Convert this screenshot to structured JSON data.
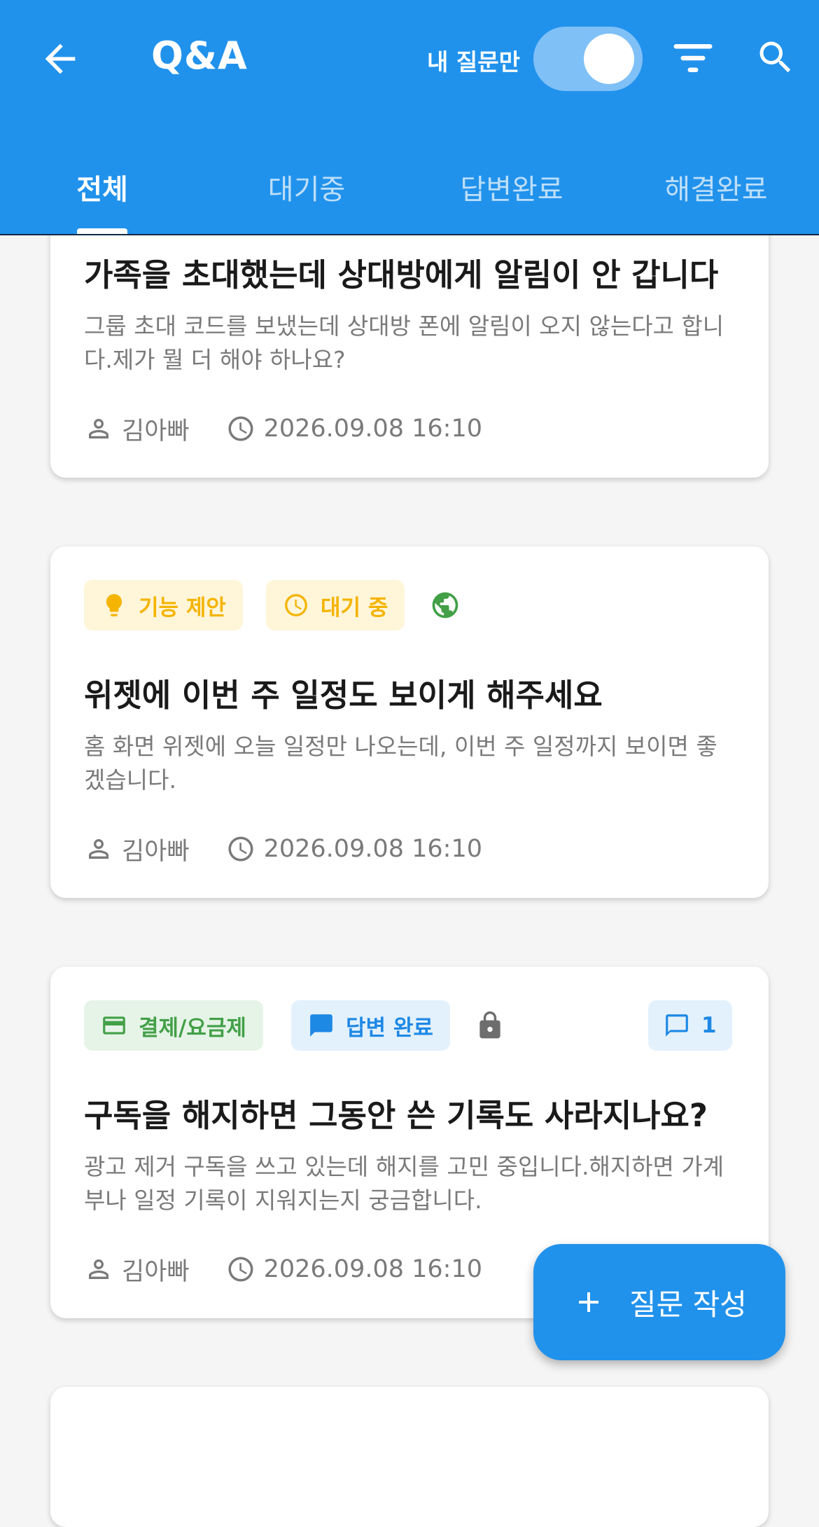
{
  "appbar": {
    "title": "Q&A",
    "my_questions_label": "내 질문만",
    "my_questions_on": true
  },
  "tabs": [
    {
      "label": "전체",
      "active": true
    },
    {
      "label": "대기중",
      "active": false
    },
    {
      "label": "답변완료",
      "active": false
    },
    {
      "label": "해결완료",
      "active": false
    }
  ],
  "posts": [
    {
      "title": "가족을 초대했는데 상대방에게 알림이 안 갑니다",
      "body": "그룹 초대 코드를 보냈는데 상대방 폰에 알림이 오지 않는다고 합니다.제가 뭘 더 해야 하나요?",
      "author": "김아빠",
      "datetime": "2026.09.08 16:10"
    },
    {
      "category": "기능 제안",
      "status": "대기 중",
      "visibility_icon": "globe-icon",
      "title": "위젯에 이번 주 일정도 보이게 해주세요",
      "body": "홈 화면 위젯에 오늘 일정만 나오는데, 이번 주 일정까지 보이면 좋겠습니다.",
      "author": "김아빠",
      "datetime": "2026.09.08 16:10"
    },
    {
      "category": "결제/요금제",
      "status": "답변 완료",
      "visibility_icon": "lock-icon",
      "comment_count": "1",
      "title": "구독을 해지하면 그동안 쓴 기록도 사라지나요?",
      "body": "광고 제거 구독을 쓰고 있는데 해지를 고민 중입니다.해지하면 가계부나 일정 기록이 지워지는지 궁금합니다.",
      "author": "김아빠",
      "datetime": "2026.09.08 16:10"
    }
  ],
  "fab": {
    "label": "질문 작성"
  },
  "colors": {
    "primary": "#2192ec",
    "yellow_chip": "#f4b400",
    "green_chip": "#43a047",
    "blue_chip": "#1e88e5"
  }
}
